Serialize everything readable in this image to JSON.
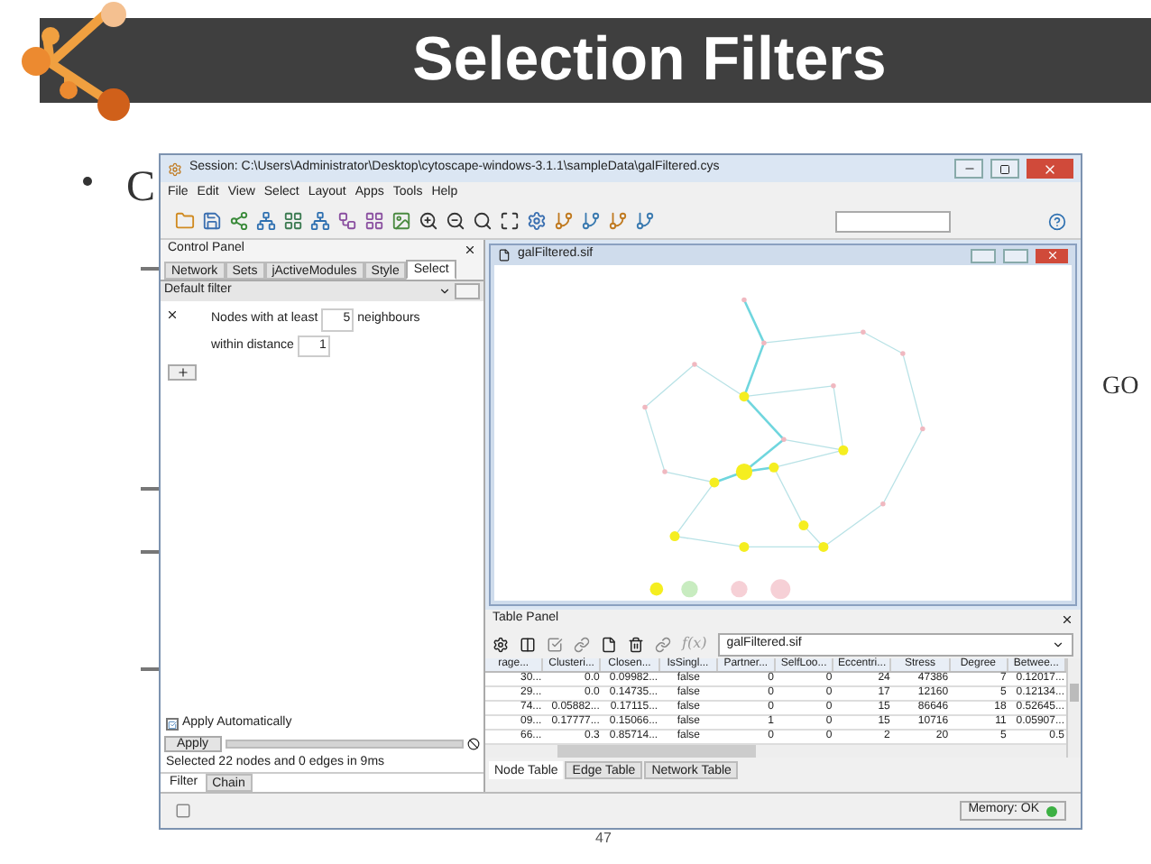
{
  "slide": {
    "title": "Selection Filters",
    "bullet_text": "C",
    "right_text": "GO",
    "page_number": "47"
  },
  "window": {
    "title": "Session: C:\\Users\\Administrator\\Desktop\\cytoscape-windows-3.1.1\\sampleData\\galFiltered.cys",
    "menu": [
      "File",
      "Edit",
      "View",
      "Select",
      "Layout",
      "Apps",
      "Tools",
      "Help"
    ]
  },
  "control_panel": {
    "title": "Control Panel",
    "tabs": [
      {
        "label": "Network",
        "selected": false
      },
      {
        "label": "Sets",
        "selected": false
      },
      {
        "label": "jActiveModules",
        "selected": false
      },
      {
        "label": "Style",
        "selected": false
      },
      {
        "label": "Select",
        "selected": true
      }
    ],
    "filter": "Default filter",
    "rule": {
      "text_before": "Nodes with at least",
      "count": "5",
      "text_after": "neighbours",
      "distance_label": "within distance",
      "distance": "1"
    },
    "apply_automatically": {
      "label": "Apply Automatically",
      "checked": true
    },
    "apply_button": "Apply",
    "apply_progress": {
      "level": 1
    },
    "result": "Selected 22 nodes and 0 edges in 9ms",
    "bottom_tabs": [
      {
        "label": "Filter",
        "selected": true
      },
      {
        "label": "Chain",
        "selected": false
      }
    ]
  },
  "network_view": {
    "title": "galFiltered.sif"
  },
  "table_panel": {
    "title": "Table Panel",
    "formula": "f(x)",
    "table_select": "galFiltered.sif",
    "columns": [
      "rage...",
      "Clusteri...",
      "Closen...",
      "IsSingl...",
      "Partner...",
      "SelfLoo...",
      "Eccentri...",
      "Stress",
      "Degree",
      "Betwee..."
    ],
    "rows": [
      [
        "30...",
        "0.0",
        "0.09982...",
        "false",
        "0",
        "0",
        "24",
        "47386",
        "7",
        "0.12017..."
      ],
      [
        "29...",
        "0.0",
        "0.14735...",
        "false",
        "0",
        "0",
        "17",
        "12160",
        "5",
        "0.12134..."
      ],
      [
        "74...",
        "0.05882...",
        "0.17115...",
        "false",
        "0",
        "0",
        "15",
        "86646",
        "18",
        "0.52645..."
      ],
      [
        "09...",
        "0.17777...",
        "0.15066...",
        "false",
        "1",
        "0",
        "15",
        "10716",
        "11",
        "0.05907..."
      ],
      [
        "66...",
        "0.3",
        "0.85714...",
        "false",
        "0",
        "0",
        "2",
        "20",
        "5",
        "0.5"
      ]
    ],
    "tabs": [
      {
        "label": "Node Table",
        "selected": true
      },
      {
        "label": "Edge Table",
        "selected": false
      },
      {
        "label": "Network Table",
        "selected": false
      }
    ]
  },
  "status_bar": {
    "memory": "Memory: OK"
  }
}
